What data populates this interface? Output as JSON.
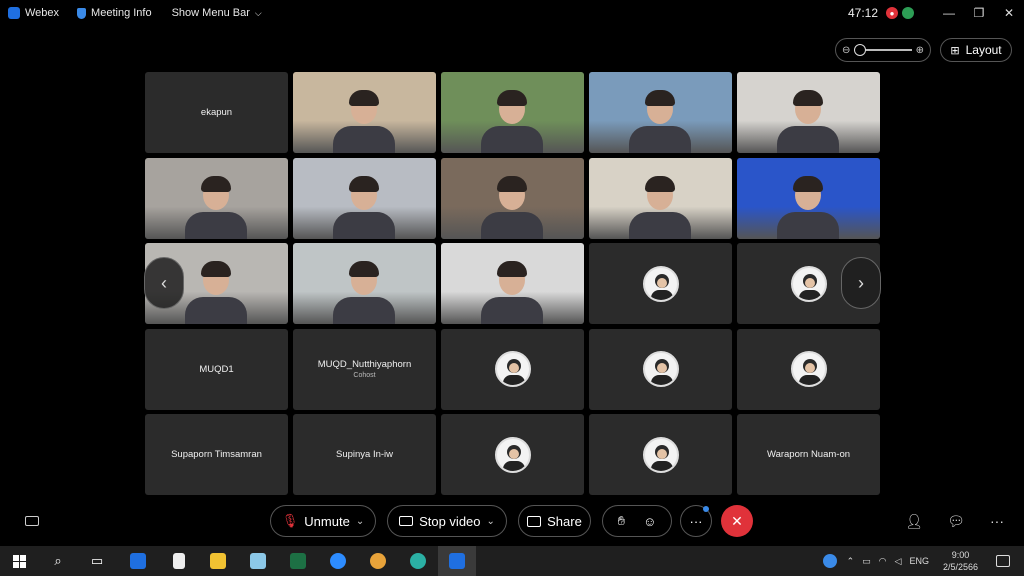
{
  "titlebar": {
    "app_name": "Webex",
    "meeting_info": "Meeting Info",
    "show_menu_bar": "Show Menu Bar",
    "timer": "47:12"
  },
  "layout_button": "Layout",
  "participants": [
    {
      "name": "ekapun",
      "type": "name"
    },
    {
      "type": "video",
      "bg": "#c8b79e"
    },
    {
      "type": "video",
      "bg": "#6f8f5a"
    },
    {
      "type": "video",
      "bg": "#7a9bbb"
    },
    {
      "type": "video",
      "bg": "#d6d3cf"
    },
    {
      "type": "video",
      "bg": "#a7a39e"
    },
    {
      "type": "video",
      "bg": "#b8bcc3"
    },
    {
      "type": "video",
      "bg": "#7a6a5c"
    },
    {
      "type": "video",
      "bg": "#d8d2c6"
    },
    {
      "type": "video",
      "bg": "#2a55c9"
    },
    {
      "type": "video",
      "bg": "#b9b7b3"
    },
    {
      "type": "video",
      "bg": "#bfc5c6"
    },
    {
      "type": "video",
      "bg": "#d9d9d9"
    },
    {
      "type": "avatar"
    },
    {
      "type": "avatar"
    },
    {
      "name": "MUQD1",
      "type": "name"
    },
    {
      "name": "MUQD_Nutthiyaphorn",
      "sub": "Cohost",
      "type": "name"
    },
    {
      "type": "avatar"
    },
    {
      "type": "avatar"
    },
    {
      "type": "avatar"
    },
    {
      "name": "Supaporn Timsamran",
      "type": "name"
    },
    {
      "name": "Supinya In-iw",
      "type": "name"
    },
    {
      "type": "avatar"
    },
    {
      "type": "avatar"
    },
    {
      "name": "Waraporn Nuam-on",
      "type": "name"
    }
  ],
  "controls": {
    "unmute": "Unmute",
    "stop_video": "Stop video",
    "share": "Share",
    "more": "···"
  },
  "taskbar": {
    "language": "ENG",
    "time": "9:00",
    "date": "2/5/2566"
  },
  "colors": {
    "end_call": "#e0323a",
    "tile_bg": "#2b2b2b",
    "webex_blue": "#1f6fe0"
  }
}
